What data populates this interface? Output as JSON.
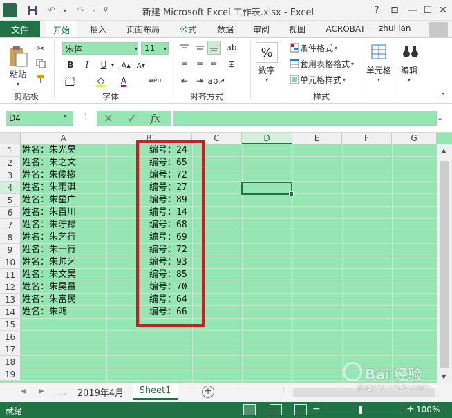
{
  "window": {
    "title": "新建 Microsoft Excel 工作表.xlsx - Excel",
    "app_logo": "X",
    "help": "?",
    "ribbon_display": "⊡",
    "minimize": "—",
    "maximize": "☐",
    "close": "✕"
  },
  "tabs": [
    "文件",
    "开始",
    "插入",
    "页面布局",
    "公式",
    "数据",
    "审阅",
    "视图",
    "ACROBAT"
  ],
  "user": {
    "name": "zhulilan"
  },
  "ribbon": {
    "paste_label": "剪贴板",
    "paste_button": "粘贴",
    "font_name": "宋体",
    "font_size": "11",
    "font_group": "字体",
    "align_group": "对齐方式",
    "number_button": "数字",
    "number_symbol": "%",
    "conditional_format": "条件格式",
    "table_format": "套用表格格式",
    "cell_style": "单元格样式",
    "styles_group": "样式",
    "cells_button": "单元格",
    "edit_button": "编辑",
    "bold": "B",
    "italic": "I",
    "underline": "U",
    "font_color_glyph": "A",
    "phonetic": "wén"
  },
  "formula_bar": {
    "name_box": "D4",
    "cancel": "✕",
    "enter": "✓",
    "fx": "fx",
    "value": ""
  },
  "columns": [
    "A",
    "B",
    "C",
    "D",
    "E",
    "F",
    "G"
  ],
  "selected_column": "D",
  "rows": [
    "1",
    "2",
    "3",
    "4",
    "5",
    "6",
    "7",
    "8",
    "9",
    "10",
    "11",
    "12",
    "13",
    "14",
    "15",
    "16",
    "17",
    "18",
    "19"
  ],
  "selected_row": "4",
  "cells": {
    "A": [
      "姓名：朱光昊",
      "姓名：朱之文",
      "姓名：朱俊椽",
      "姓名：朱雨淇",
      "姓名：朱星广",
      "姓名：朱百川",
      "姓名：朱泞禄",
      "姓名：朱艺行",
      "姓名：朱一行",
      "姓名：朱帅艺",
      "姓名：朱文昊",
      "姓名：朱昊昌",
      "姓名：朱富民",
      "姓名：朱鸿"
    ],
    "B": [
      "编号：24",
      "编号：65",
      "编号：72",
      "编号：27",
      "编号：89",
      "编号：14",
      "编号：68",
      "编号：69",
      "编号：72",
      "编号：93",
      "编号：85",
      "编号：70",
      "编号：64",
      "编号：66"
    ]
  },
  "sheet_tabs": [
    "2019年4月",
    "Sheet1"
  ],
  "active_sheet": "Sheet1",
  "add_sheet": "+",
  "status": {
    "text": "就绪",
    "zoom": "100%",
    "zoom_minus": "−",
    "zoom_plus": "+"
  },
  "watermark": {
    "brand": "Bai 经验",
    "url": "jingyan.baidu.com"
  },
  "colors": {
    "excel_green": "#217346",
    "cell_fill": "#96e6b4",
    "highlight_red": "#e0141e"
  }
}
